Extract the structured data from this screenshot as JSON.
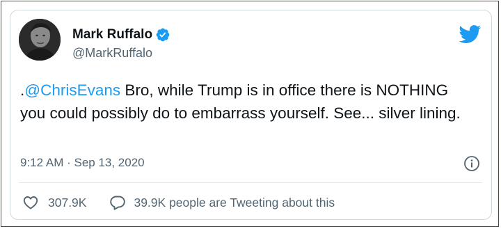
{
  "user": {
    "display_name": "Mark Ruffalo",
    "handle": "@MarkRuffalo",
    "verified": true,
    "avatar_icon": "profile-photo"
  },
  "brand": {
    "icon": "twitter-bird-icon",
    "color": "#1d9bf0"
  },
  "tweet": {
    "prefix": ".",
    "mention": "@ChrisEvans",
    "body": " Bro, while Trump is in office there is NOTHING you could possibly do to embarrass yourself. See... silver lining."
  },
  "meta": {
    "timestamp": "9:12 AM · Sep 13, 2020",
    "info_icon": "info-icon"
  },
  "actions": {
    "likes": "307.9K",
    "like_icon": "heart-icon",
    "tweeting": "39.9K people are Tweeting about this",
    "reply_icon": "speech-bubble-icon"
  },
  "colors": {
    "text": "#0f1419",
    "secondary": "#536471",
    "link": "#1d9bf0",
    "border": "#cfd9de"
  }
}
